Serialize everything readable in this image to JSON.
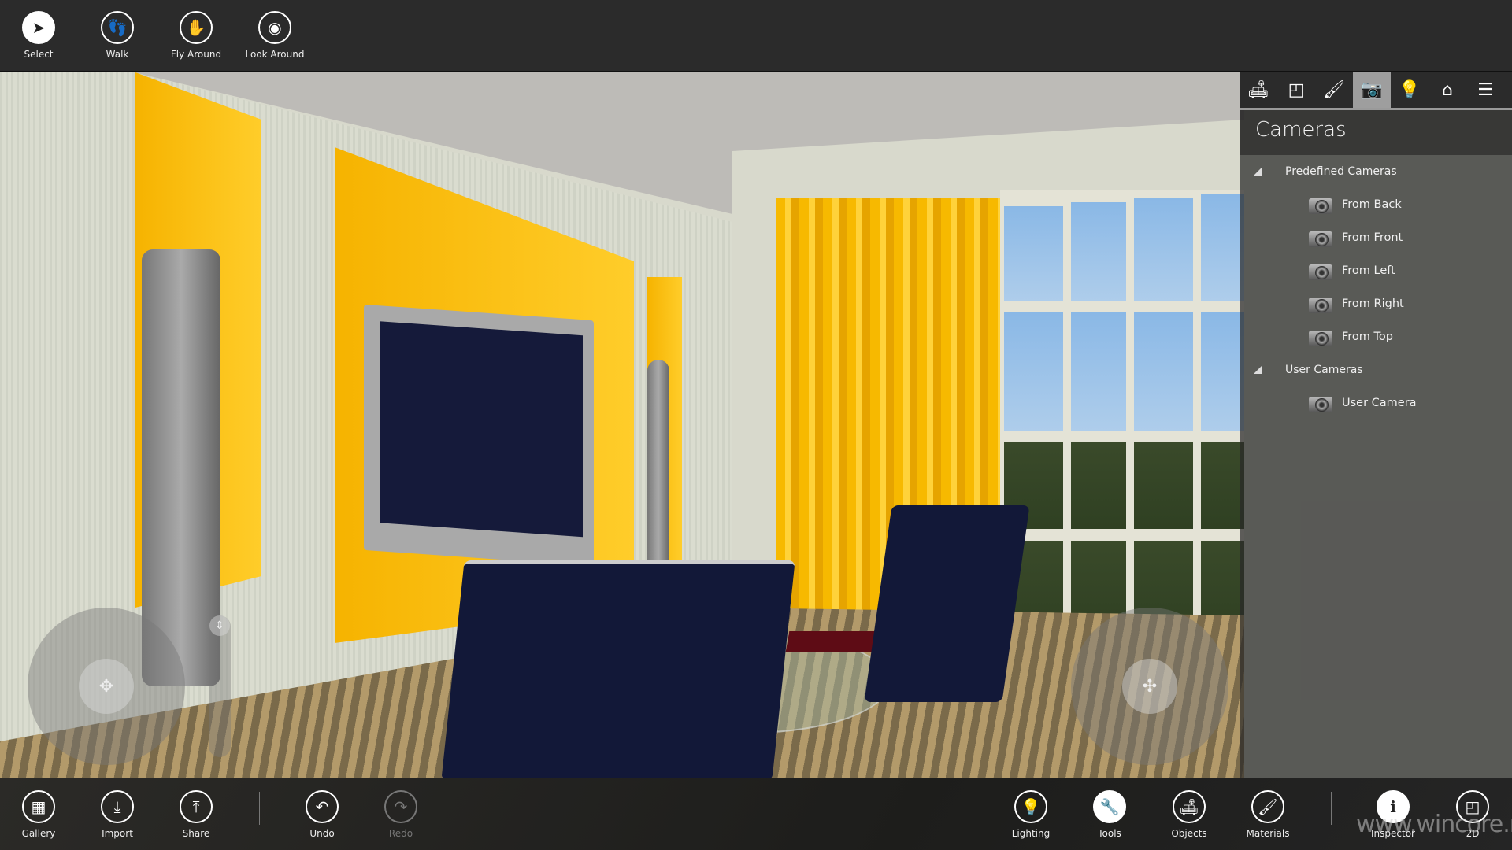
{
  "toolbar": {
    "modes": [
      {
        "label": "Select",
        "icon": "cursor-arrow-icon"
      },
      {
        "label": "Walk",
        "icon": "footprints-icon"
      },
      {
        "label": "Fly Around",
        "icon": "hand-icon"
      },
      {
        "label": "Look Around",
        "icon": "eye-icon"
      }
    ]
  },
  "panel": {
    "tabs": [
      {
        "icon": "sofa-icon"
      },
      {
        "icon": "floorplan-icon"
      },
      {
        "icon": "brush-icon"
      },
      {
        "icon": "camera-icon",
        "active": true
      },
      {
        "icon": "lightbulb-icon"
      },
      {
        "icon": "home-icon"
      },
      {
        "icon": "list-icon"
      }
    ],
    "title": "Cameras",
    "groups": [
      {
        "label": "Predefined Cameras",
        "expanded": true,
        "items": [
          "From Back",
          "From Front",
          "From Left",
          "From Right",
          "From Top"
        ]
      },
      {
        "label": "User Cameras",
        "expanded": true,
        "items": [
          "User Camera"
        ]
      }
    ]
  },
  "bottombar": {
    "left": [
      {
        "label": "Gallery",
        "icon": "gallery-icon"
      },
      {
        "label": "Import",
        "icon": "import-icon"
      },
      {
        "label": "Share",
        "icon": "share-icon"
      },
      {
        "label": "Undo",
        "icon": "undo-icon"
      },
      {
        "label": "Redo",
        "icon": "redo-icon",
        "disabled": true
      }
    ],
    "right": [
      {
        "label": "Lighting",
        "icon": "lighting-icon"
      },
      {
        "label": "Tools",
        "icon": "wrench-icon"
      },
      {
        "label": "Objects",
        "icon": "armchair-icon"
      },
      {
        "label": "Materials",
        "icon": "brush-icon"
      },
      {
        "label": "Inspector",
        "icon": "info-icon"
      },
      {
        "label": "2D",
        "icon": "floorplan-icon"
      }
    ]
  },
  "watermark": "www.wincore.ru",
  "colors": {
    "accent_yellow": "#f6b300",
    "bar": "#2b2b2b",
    "active_tab": "#9e9e9e"
  }
}
